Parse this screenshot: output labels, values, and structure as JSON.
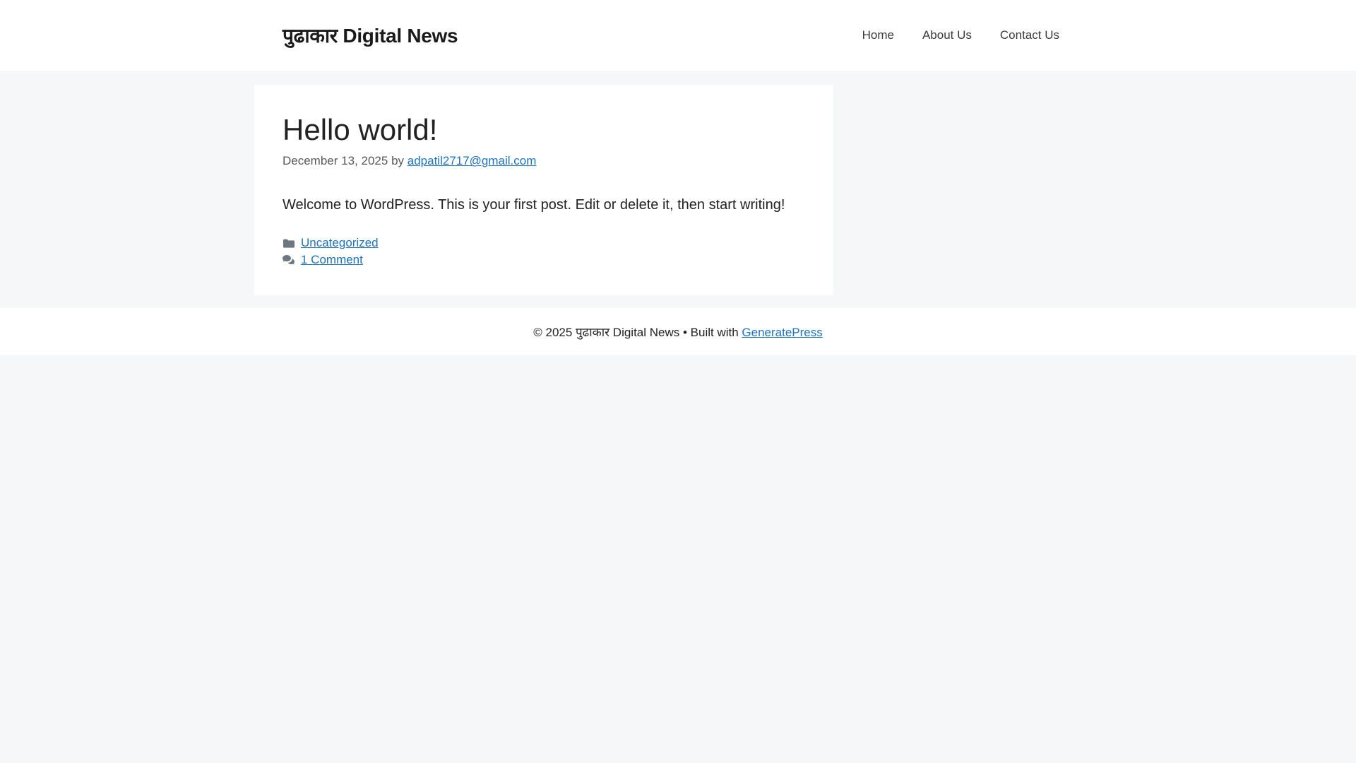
{
  "header": {
    "site_title": "पुढाकार Digital News",
    "nav": [
      {
        "label": "Home"
      },
      {
        "label": "About Us"
      },
      {
        "label": "Contact Us"
      }
    ]
  },
  "post": {
    "title": "Hello world!",
    "date": "December 13, 2025",
    "by_label": "by",
    "author": "adpatil2717@gmail.com",
    "body": "Welcome to WordPress. This is your first post. Edit or delete it, then start writing!",
    "category": "Uncategorized",
    "comments": "1 Comment"
  },
  "footer": {
    "copyright": "© 2025 पुढाकार Digital News • Built with",
    "builder_link": "GeneratePress"
  },
  "colors": {
    "link": "#1e73be",
    "meta_gray": "#595959",
    "icon_gray": "#6e7781",
    "background": "#f6f7f8",
    "surface": "#ffffff",
    "text": "#222222"
  },
  "icons": [
    {
      "name": "folder-icon",
      "meaning": "post categories"
    },
    {
      "name": "comments-icon",
      "meaning": "comment count"
    }
  ]
}
